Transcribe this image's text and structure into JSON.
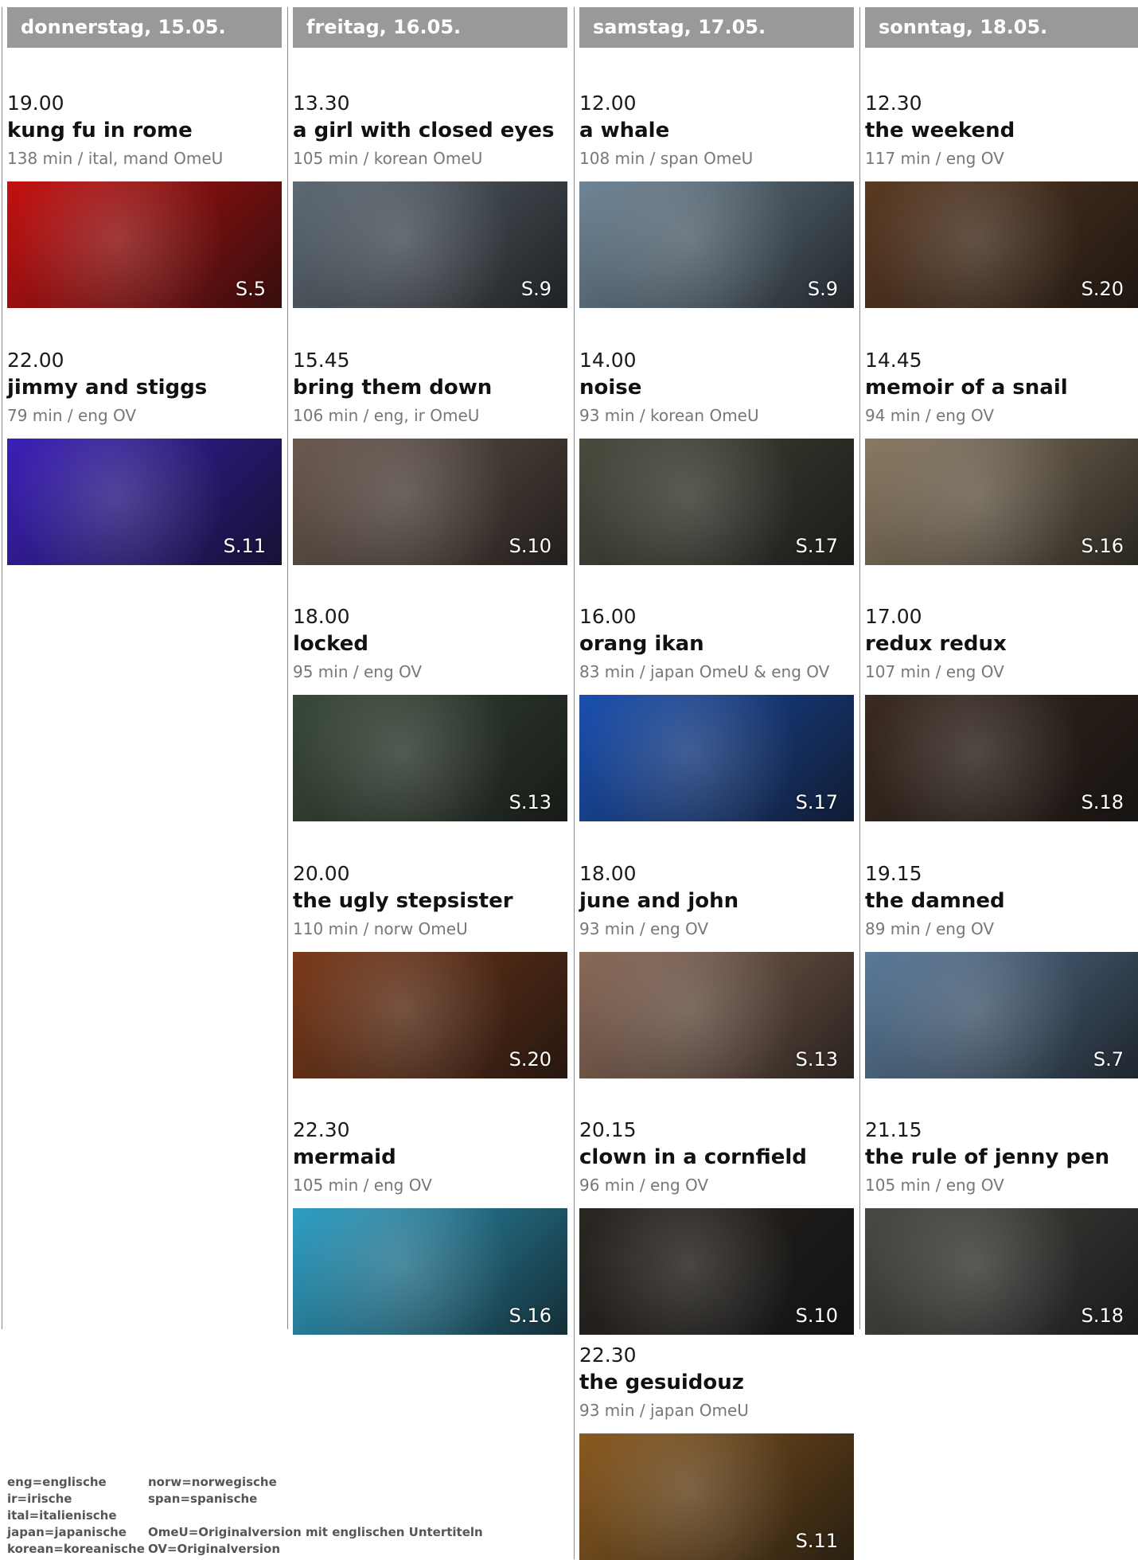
{
  "days": [
    {
      "header": "donnerstag, 15.05.",
      "films": [
        {
          "time": "19.00",
          "title": "kung fu in rome",
          "meta": "138 min / ital, mand OmeU",
          "page": "S.5",
          "color": "#c41010"
        },
        {
          "time": "22.00",
          "title": "jimmy and stiggs",
          "meta": "79 min / eng OV",
          "page": "S.11",
          "color": "#3b1fb8"
        }
      ]
    },
    {
      "header": "freitag, 16.05.",
      "films": [
        {
          "time": "13.30",
          "title": "a girl with closed eyes",
          "meta": "105 min / korean OmeU",
          "page": "S.9",
          "color": "#5e6a74"
        },
        {
          "time": "15.45",
          "title": "bring them down",
          "meta": "106 min / eng, ir OmeU",
          "page": "S.10",
          "color": "#6b5a50"
        },
        {
          "time": "18.00",
          "title": "locked",
          "meta": "95 min / eng OV",
          "page": "S.13",
          "color": "#3a4a3a"
        },
        {
          "time": "20.00",
          "title": "the ugly stepsister",
          "meta": "110 min / norw OmeU",
          "page": "S.20",
          "color": "#7a3a1a"
        },
        {
          "time": "22.30",
          "title": "mermaid",
          "meta": "105 min / eng OV",
          "page": "S.16",
          "color": "#2f9fc4"
        }
      ]
    },
    {
      "header": "samstag, 17.05.",
      "films": [
        {
          "time": "12.00",
          "title": "a whale",
          "meta": "108 min / span OmeU",
          "page": "S.9",
          "color": "#6f8596"
        },
        {
          "time": "14.00",
          "title": "noise",
          "meta": "93 min / korean OmeU",
          "page": "S.17",
          "color": "#4a4a3e"
        },
        {
          "time": "16.00",
          "title": "orang ikan",
          "meta": "83 min / japan OmeU & eng OV",
          "page": "S.17",
          "color": "#1a4fb0"
        },
        {
          "time": "18.00",
          "title": "june and john",
          "meta": "93 min / eng OV",
          "page": "S.13",
          "color": "#8a6a58"
        },
        {
          "time": "20.15",
          "title": "clown in a cornfield",
          "meta": "96 min / eng OV",
          "page": "S.10",
          "color": "#2a2622"
        },
        {
          "time": "22.30",
          "title": "the gesuidouz",
          "meta": "93 min / japan OmeU",
          "page": "S.11",
          "color": "#8a5a20"
        }
      ]
    },
    {
      "header": "sonntag, 18.05.",
      "films": [
        {
          "time": "12.30",
          "title": "the weekend",
          "meta": "117 min / eng OV",
          "page": "S.20",
          "color": "#5a3a22"
        },
        {
          "time": "14.45",
          "title": "memoir of a snail",
          "meta": "94 min / eng OV",
          "page": "S.16",
          "color": "#8a7a62"
        },
        {
          "time": "17.00",
          "title": "redux redux",
          "meta": "107 min / eng OV",
          "page": "S.18",
          "color": "#3a2a20"
        },
        {
          "time": "19.15",
          "title": "the damned",
          "meta": "89 min / eng OV",
          "page": "S.7",
          "color": "#5a7a9a"
        },
        {
          "time": "21.15",
          "title": "the rule of jenny pen",
          "meta": "105 min / eng OV",
          "page": "S.18",
          "color": "#4a4844"
        }
      ]
    }
  ],
  "legend": {
    "left": [
      "eng=englische",
      "ir=irische",
      "ital=italienische",
      "japan=japanische",
      "korean=koreanische"
    ],
    "right": [
      "norw=norwegische",
      "span=spanische",
      "",
      "OmeU=Originalversion mit englischen Untertiteln",
      "OV=Originalversion"
    ]
  }
}
